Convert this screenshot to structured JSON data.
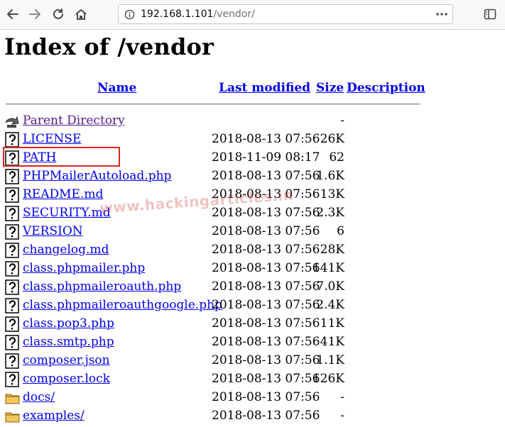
{
  "browser": {
    "url_host": "192.168.1.101",
    "url_path": "/vendor/",
    "icons": [
      "back-icon",
      "forward-icon",
      "reload-icon",
      "home-icon",
      "info-icon",
      "more-actions-icon",
      "sidebar-icon"
    ]
  },
  "page": {
    "title": "Index of /vendor",
    "watermark": "www.hackingarticles.in"
  },
  "table": {
    "headers": {
      "name": "Name",
      "last_modified": "Last modified",
      "size": "Size",
      "description": "Description"
    },
    "rows": [
      {
        "icon": "back-arrow-icon",
        "name": "Parent Directory",
        "date": "",
        "size": "-"
      },
      {
        "icon": "unknown-file-icon",
        "name": "LICENSE",
        "date": "2018-08-13 07:56",
        "size": "26K"
      },
      {
        "icon": "unknown-file-icon",
        "name": "PATH",
        "date": "2018-11-09 08:17",
        "size": "62"
      },
      {
        "icon": "unknown-file-icon",
        "name": "PHPMailerAutoload.php",
        "date": "2018-08-13 07:56",
        "size": "1.6K"
      },
      {
        "icon": "unknown-file-icon",
        "name": "README.md",
        "date": "2018-08-13 07:56",
        "size": "13K"
      },
      {
        "icon": "unknown-file-icon",
        "name": "SECURITY.md",
        "date": "2018-08-13 07:56",
        "size": "2.3K"
      },
      {
        "icon": "unknown-file-icon",
        "name": "VERSION",
        "date": "2018-08-13 07:56",
        "size": "6"
      },
      {
        "icon": "unknown-file-icon",
        "name": "changelog.md",
        "date": "2018-08-13 07:56",
        "size": "28K"
      },
      {
        "icon": "unknown-file-icon",
        "name": "class.phpmailer.php",
        "date": "2018-08-13 07:56",
        "size": "141K"
      },
      {
        "icon": "unknown-file-icon",
        "name": "class.phpmaileroauth.php",
        "date": "2018-08-13 07:56",
        "size": "7.0K"
      },
      {
        "icon": "unknown-file-icon",
        "name": "class.phpmaileroauthgoogle.php",
        "date": "2018-08-13 07:56",
        "size": "2.4K"
      },
      {
        "icon": "unknown-file-icon",
        "name": "class.pop3.php",
        "date": "2018-08-13 07:56",
        "size": "11K"
      },
      {
        "icon": "unknown-file-icon",
        "name": "class.smtp.php",
        "date": "2018-08-13 07:56",
        "size": "41K"
      },
      {
        "icon": "unknown-file-icon",
        "name": "composer.json",
        "date": "2018-08-13 07:56",
        "size": "1.1K"
      },
      {
        "icon": "unknown-file-icon",
        "name": "composer.lock",
        "date": "2018-08-13 07:56",
        "size": "126K"
      },
      {
        "icon": "folder-icon",
        "name": "docs/",
        "date": "2018-08-13 07:56",
        "size": "-"
      },
      {
        "icon": "folder-icon",
        "name": "examples/",
        "date": "2018-08-13 07:56",
        "size": "-"
      }
    ]
  },
  "colors": {
    "link": "#0000ee",
    "visited": "#551a8b",
    "highlight": "#d9261c"
  }
}
